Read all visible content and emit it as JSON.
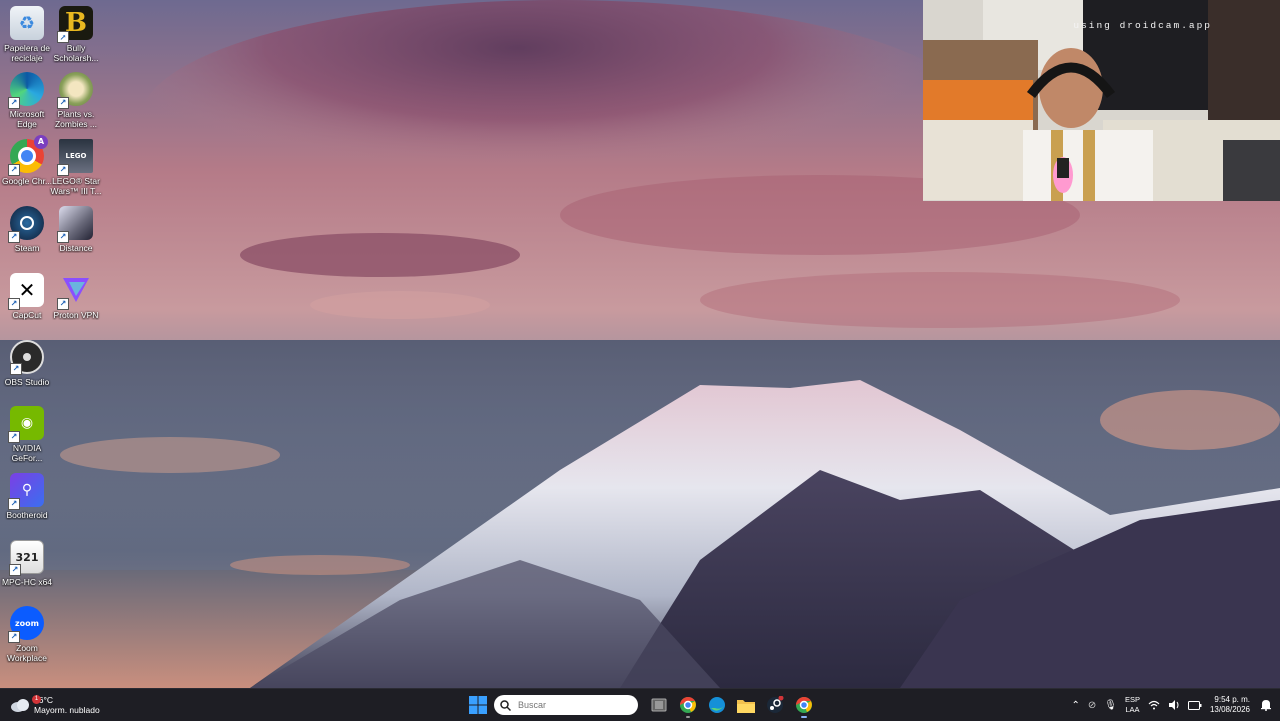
{
  "desktop": {
    "icons": [
      {
        "label": "Papelera de reciclaje",
        "icon": "recycle-bin-icon"
      },
      {
        "label": "Bully Scholarsh...",
        "icon": "bully-icon"
      },
      {
        "label": "Microsoft Edge",
        "icon": "edge-icon"
      },
      {
        "label": "Plants vs. Zombies ...",
        "icon": "plants-vs-zombies-icon"
      },
      {
        "label": "Google Chr...",
        "icon": "chrome-icon"
      },
      {
        "label": "LEGO® Star Wars™ III T...",
        "icon": "lego-star-wars-icon"
      },
      {
        "label": "Steam",
        "icon": "steam-icon"
      },
      {
        "label": "Distance",
        "icon": "distance-icon"
      },
      {
        "label": "CapCut",
        "icon": "capcut-icon"
      },
      {
        "label": "Proton VPN",
        "icon": "proton-vpn-icon"
      },
      {
        "label": "OBS Studio",
        "icon": "obs-icon"
      },
      {
        "label": "NVIDIA GeFor...",
        "icon": "nvidia-icon"
      },
      {
        "label": "Bootheroid",
        "icon": "bootheroid-icon"
      },
      {
        "label": "MPC-HC x64",
        "icon": "mpc-hc-icon"
      },
      {
        "label": "Zoom Workplace",
        "icon": "zoom-icon"
      }
    ],
    "chrome_profile_badge": "A",
    "zoom_logo_text": "zoom",
    "mpc_logo_text": "321",
    "bully_logo_text": "B"
  },
  "webcam": {
    "watermark": "using droidcam.app"
  },
  "taskbar": {
    "weather": {
      "temp": "26°C",
      "condition": "Mayorm. nublado",
      "badge": "1"
    },
    "search": {
      "placeholder": "Buscar"
    },
    "pinned": [
      "windows-start",
      "task-view",
      "chrome",
      "edge",
      "file-explorer",
      "steam",
      "chrome-active"
    ],
    "tray": {
      "lang_top": "ESP",
      "lang_bottom": "LAA",
      "time": "9:54 p. m.",
      "date": "13/08/2026"
    }
  },
  "colors": {
    "taskbar_bg": "#1e1e24",
    "accent": "#0078d4"
  }
}
